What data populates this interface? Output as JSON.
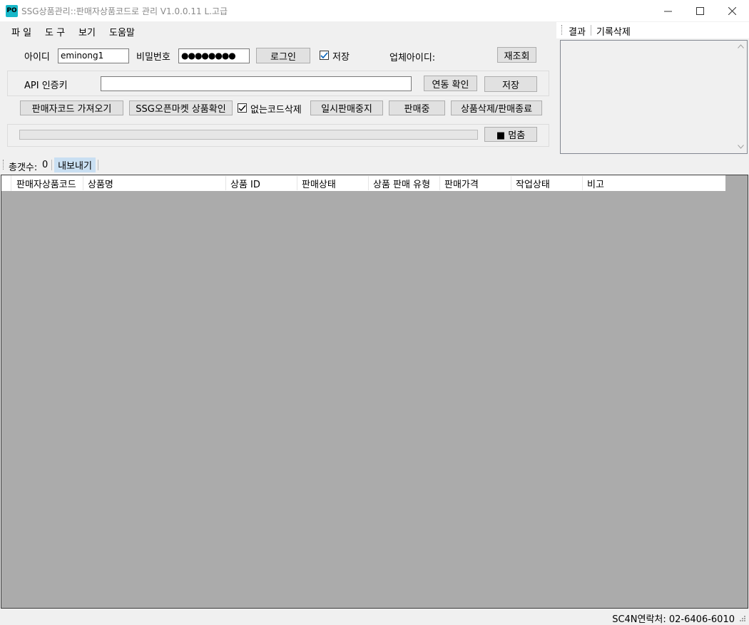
{
  "window": {
    "icon_text": "PO",
    "title": "SSG상품관리::판매자상품코드로 관리  V1.0.0.11 L.고급"
  },
  "menu": [
    "파 일",
    "도 구",
    "보기",
    "도움말"
  ],
  "login": {
    "id_label": "아이디",
    "id_value": "eminong1",
    "pw_label": "비밀번호",
    "pw_value": "●●●●●●●●",
    "login_button": "로그인",
    "save_checkbox": "저장",
    "vendor_label": "업체아이디:",
    "refresh_button": "재조회"
  },
  "api": {
    "label": "API 인증키",
    "value": "",
    "check_button": "연동 확인",
    "save_button": "저장"
  },
  "actions": {
    "fetch_codes": "판매자코드 가져오기",
    "check_products": "SSG오픈마켓 상품확인",
    "delete_missing_checkbox": "없는코드삭제",
    "pause_sale": "일시판매중지",
    "on_sale": "판매중",
    "delete_end": "상품삭제/판매종료"
  },
  "progress": {
    "value": 0
  },
  "stop_button": "■ 멈춤",
  "result": {
    "tab": "결과",
    "clear": "기록삭제"
  },
  "strip": {
    "count_label": "총갯수:",
    "count_value": "0",
    "export_button": "내보내기"
  },
  "grid": {
    "columns": [
      "판매자상품코드",
      "상품명",
      "상품 ID",
      "판매상태",
      "상품 판매 유형",
      "판매가격",
      "작업상태",
      "비고"
    ]
  },
  "status": {
    "contact": "SC4N연락처: 02-6406-6010"
  }
}
